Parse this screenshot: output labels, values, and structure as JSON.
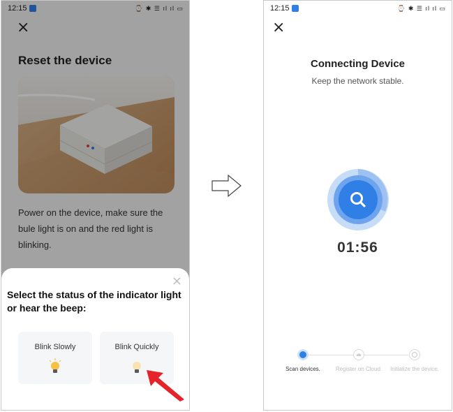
{
  "status_bar": {
    "time": "12:15",
    "icons": "⌚ ✱ ☰ ıl ıl ▭"
  },
  "left_screen": {
    "close_icon": "×",
    "title": "Reset the device",
    "instruction": "Power on the device, make sure the bule light is on and the red light is blinking.",
    "sheet": {
      "close_icon": "×",
      "title": "Select the status of the indicator light or hear the beep:",
      "options": [
        {
          "label": "Blink Slowly",
          "icon": "bulb-lit-icon"
        },
        {
          "label": "Blink Quickly",
          "icon": "bulb-dim-icon"
        }
      ]
    }
  },
  "right_screen": {
    "close_icon": "×",
    "title": "Connecting Device",
    "subtitle": "Keep the network stable.",
    "timer": "01:56",
    "steps": [
      {
        "label": "Scan devices.",
        "active": true
      },
      {
        "label": "Register on Cloud.",
        "active": false
      },
      {
        "label": "Initialize the device.",
        "active": false
      }
    ]
  },
  "colors": {
    "accent_blue": "#2f7fe6",
    "bulb_yellow": "#f7c244",
    "pointer_red": "#e5232a"
  }
}
